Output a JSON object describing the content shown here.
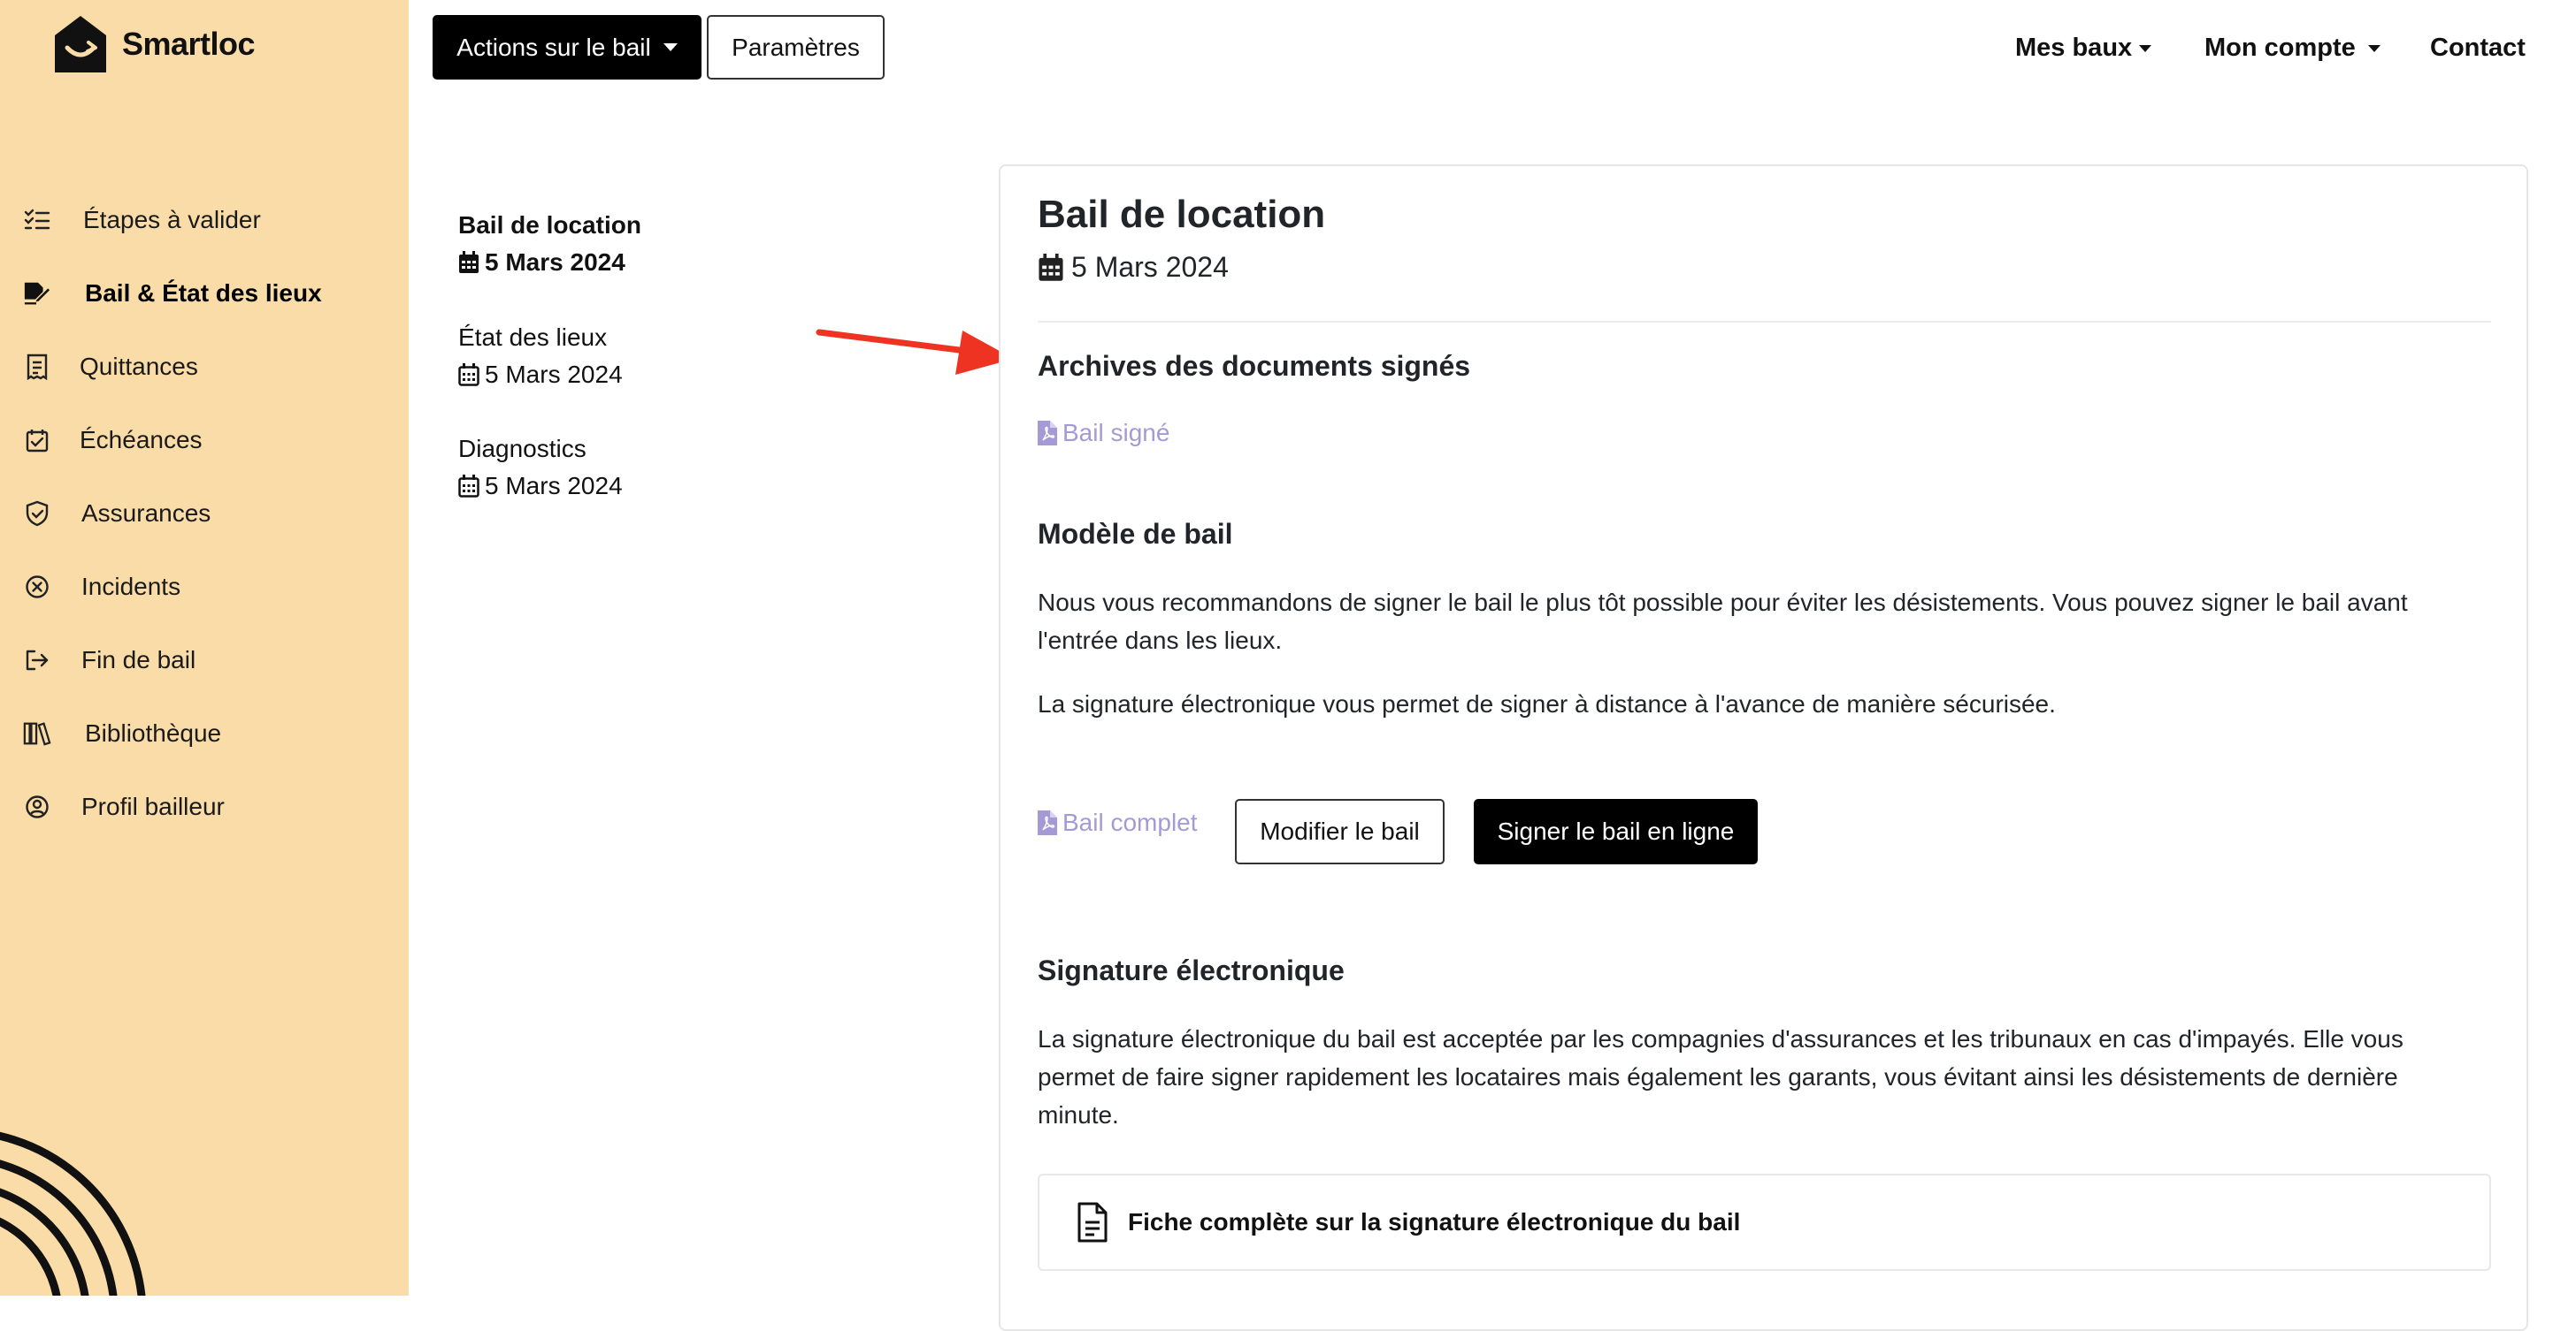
{
  "brand": {
    "name": "Smartloc"
  },
  "sidebar": {
    "items": [
      {
        "label": "Étapes à valider",
        "icon": "checklist-icon"
      },
      {
        "label": "Bail & État des lieux",
        "icon": "signature-icon",
        "active": true
      },
      {
        "label": "Quittances",
        "icon": "receipt-icon"
      },
      {
        "label": "Échéances",
        "icon": "calendar-check-icon"
      },
      {
        "label": "Assurances",
        "icon": "shield-check-icon"
      },
      {
        "label": "Incidents",
        "icon": "x-circle-icon"
      },
      {
        "label": "Fin de bail",
        "icon": "exit-icon"
      },
      {
        "label": "Bibliothèque",
        "icon": "books-icon"
      },
      {
        "label": "Profil bailleur",
        "icon": "user-circle-icon"
      }
    ]
  },
  "toolbar": {
    "actions_label": "Actions sur le bail",
    "settings_label": "Paramètres"
  },
  "topnav": {
    "leases_label": "Mes baux",
    "account_label": "Mon compte",
    "contact_label": "Contact"
  },
  "documents": [
    {
      "title": "Bail de location",
      "date": "5 Mars 2024",
      "active": true
    },
    {
      "title": "État des lieux",
      "date": "5 Mars 2024"
    },
    {
      "title": "Diagnostics",
      "date": "5 Mars 2024"
    }
  ],
  "main": {
    "title": "Bail de location",
    "date": "5 Mars 2024",
    "archives": {
      "heading": "Archives des documents signés",
      "signed_link": "Bail signé"
    },
    "model": {
      "heading": "Modèle de bail",
      "para1": "Nous vous recommandons de signer le bail le plus tôt possible pour éviter les désistements. Vous pouvez signer le bail avant l'entrée dans les lieux.",
      "para2": "La signature électronique vous permet de signer à distance à l'avance de manière sécurisée.",
      "full_link": "Bail complet",
      "edit_label": "Modifier le bail",
      "sign_label": "Signer le bail en ligne"
    },
    "esign": {
      "heading": "Signature électronique",
      "para": "La signature électronique du bail est acceptée par les compagnies d'assurances et les tribunaux en cas d'impayés. Elle vous permet de faire signer rapidement les locataires mais également les garants, vous évitant ainsi les désistements de dernière minute.",
      "fiche_label": "Fiche complète sur la signature électronique du bail"
    }
  },
  "colors": {
    "sidebar_bg": "#f9dca7",
    "link_purple": "#a59ad6",
    "arrow_red": "#ee3322"
  }
}
